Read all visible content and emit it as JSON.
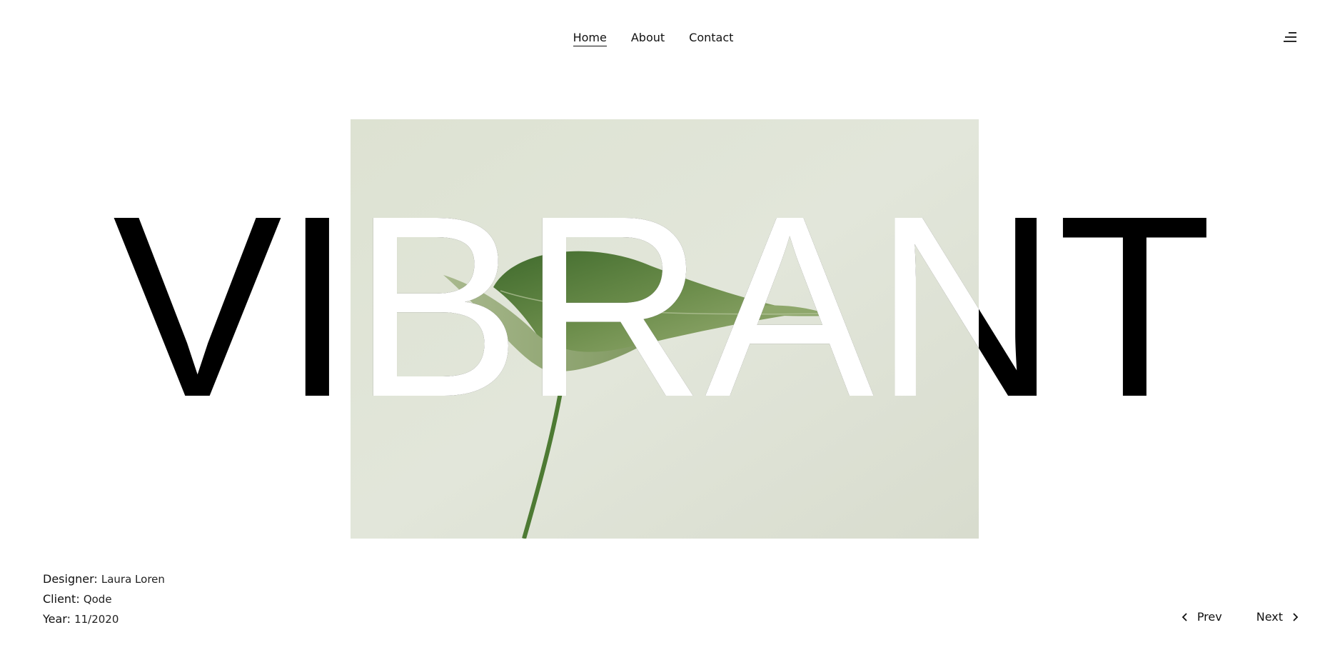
{
  "nav": {
    "items": [
      {
        "label": "Home",
        "active": true
      },
      {
        "label": "About",
        "active": false
      },
      {
        "label": "Contact",
        "active": false
      }
    ],
    "menu_icon": "hamburger-menu-icon"
  },
  "hero": {
    "title": "VIBRANT",
    "image": "green-leaf-on-sage-background"
  },
  "project": {
    "designer_label": "Designer:",
    "designer_value": "Laura Loren",
    "client_label": "Client:",
    "client_value": "Qode",
    "year_label": "Year:",
    "year_value": "11/2020"
  },
  "pager": {
    "prev_label": "Prev",
    "next_label": "Next"
  },
  "colors": {
    "background": "#ffffff",
    "text": "#111111",
    "image_background": "#dfe3d5",
    "leaf": "#5d7f45"
  }
}
